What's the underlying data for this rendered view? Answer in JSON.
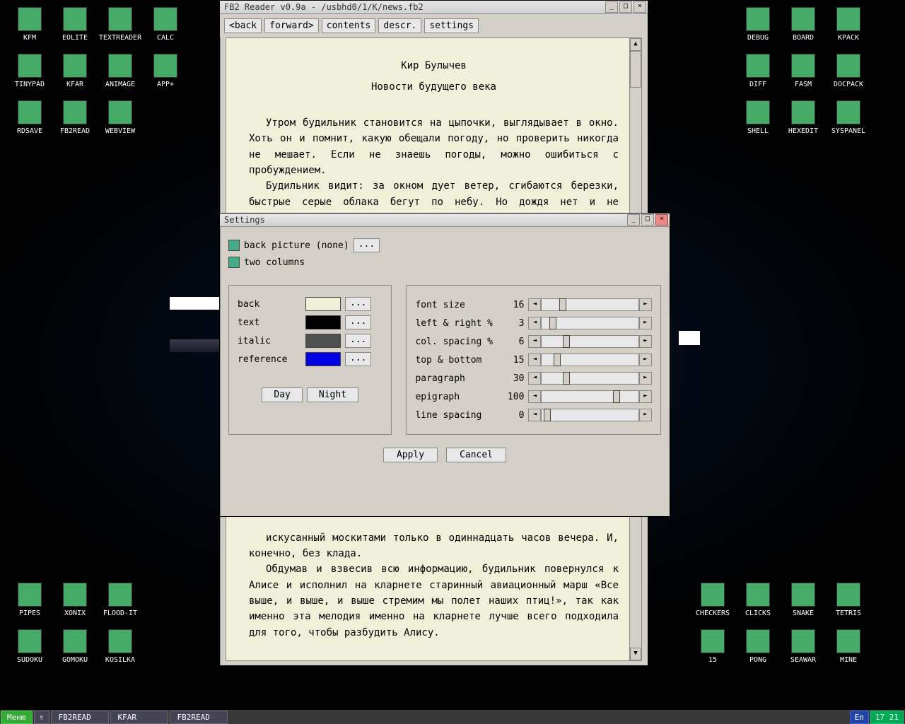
{
  "desktop_icons_left": [
    {
      "label": "KFM",
      "cls": "i-floppy"
    },
    {
      "label": "EOLITE",
      "cls": "i-folder"
    },
    {
      "label": "TEXTREADER",
      "cls": "i-book"
    },
    {
      "label": "CALC",
      "cls": "i-calc"
    },
    {
      "label": "TINYPAD",
      "cls": "i-pencil"
    },
    {
      "label": "KFAR",
      "cls": "i-kfar"
    },
    {
      "label": "ANIMAGE",
      "cls": "i-animage"
    },
    {
      "label": "APP+",
      "cls": "i-cube"
    },
    {
      "label": "RDSAVE",
      "cls": "i-rdsave"
    },
    {
      "label": "FB2READ",
      "cls": "i-fb2"
    },
    {
      "label": "WEBVIEW",
      "cls": "i-web"
    }
  ],
  "desktop_icons_right": [
    {
      "label": "DEBUG",
      "cls": "i-debug"
    },
    {
      "label": "BOARD",
      "cls": "i-board"
    },
    {
      "label": "KPACK",
      "cls": "i-kpack"
    },
    {
      "label": "DIFF",
      "cls": "i-diff"
    },
    {
      "label": "FASM",
      "cls": "i-fasm"
    },
    {
      "label": "DOCPACK",
      "cls": "i-docpack"
    },
    {
      "label": "SHELL",
      "cls": "i-shell"
    },
    {
      "label": "HEXEDIT",
      "cls": "i-hexedit"
    },
    {
      "label": "SYSPANEL",
      "cls": "i-syspanel"
    }
  ],
  "desktop_icons_bl": [
    {
      "label": "PIPES",
      "cls": "i-pipes"
    },
    {
      "label": "XONIX",
      "cls": "i-xonix"
    },
    {
      "label": "FLOOD-IT",
      "cls": "i-flood"
    },
    {
      "label": "SUDOKU",
      "cls": "i-sudoku"
    },
    {
      "label": "GOMOKU",
      "cls": "i-gomoku"
    },
    {
      "label": "KOSILKA",
      "cls": "i-kosilka"
    }
  ],
  "desktop_icons_br": [
    {
      "label": "CHECKERS",
      "cls": "i-checkers"
    },
    {
      "label": "CLICKS",
      "cls": "i-clicks"
    },
    {
      "label": "SNAKE",
      "cls": "i-snake"
    },
    {
      "label": "TETRIS",
      "cls": "i-tetris"
    },
    {
      "label": "15",
      "cls": "i-15"
    },
    {
      "label": "PONG",
      "cls": "i-pong"
    },
    {
      "label": "SEAWAR",
      "cls": "i-seawar"
    },
    {
      "label": "MINE",
      "cls": "i-mine"
    }
  ],
  "reader": {
    "title": "FB2 Reader v0.9a - /usbhd0/1/K/news.fb2",
    "buttons": {
      "back": "<back",
      "forward": "forward>",
      "contents": "contents",
      "descr": "descr.",
      "settings": "settings"
    },
    "doc_author": "Кир Булычев",
    "doc_title": "Новости будущего века",
    "para1": "Утром будильник становится на цыпочки, выглядывает в окно. Хоть он и помнит, какую обещали погоду, но проверить никогда не мешает. Если не знаешь погоды, можно ошибиться с пробуждением.",
    "para2": "Будильник видит: за окном дует ветер, сгибаются березки, быстрые серые облака бегут по небу. Но дождя нет и не предвидится.",
    "para3": "искусанный москитами только в одиннадцать часов вечера. И, конечно, без клада.",
    "para4": "Обдумав и взвесив всю информацию, будильник повернулся к Алисе и исполнил на кларнете старинный авиационный марш «Все выше, и выше, и выше стремим мы полет наших птиц!», так как именно эта мелодия именно на кларнете лучше всего подходила для того, чтобы разбудить Алису."
  },
  "settings": {
    "title": "Settings",
    "back_picture": "back picture (none)",
    "two_columns": "two columns",
    "ellipsis": "...",
    "colors": {
      "back": {
        "label": "back",
        "hex": "#f0f0d8"
      },
      "text": {
        "label": "text",
        "hex": "#000000"
      },
      "italic": {
        "label": "italic",
        "hex": "#505050"
      },
      "reference": {
        "label": "reference",
        "hex": "#0000e0"
      }
    },
    "day": "Day",
    "night": "Night",
    "sliders": {
      "font": {
        "label": "font size",
        "val": "16",
        "pos": 18
      },
      "lr": {
        "label": "left & right %",
        "val": "3",
        "pos": 8
      },
      "col": {
        "label": "col. spacing %",
        "val": "6",
        "pos": 22
      },
      "tb": {
        "label": "top & bottom",
        "val": "15",
        "pos": 12
      },
      "para": {
        "label": "paragraph",
        "val": "30",
        "pos": 22
      },
      "epi": {
        "label": "epigraph",
        "val": "100",
        "pos": 74
      },
      "line": {
        "label": "line spacing",
        "val": "0",
        "pos": 2
      }
    },
    "apply": "Apply",
    "cancel": "Cancel"
  },
  "taskbar": {
    "menu": "Меню",
    "tasks": [
      "FB2READ",
      "KFAR",
      "FB2READ"
    ],
    "lang": "En",
    "time": "17 21"
  }
}
